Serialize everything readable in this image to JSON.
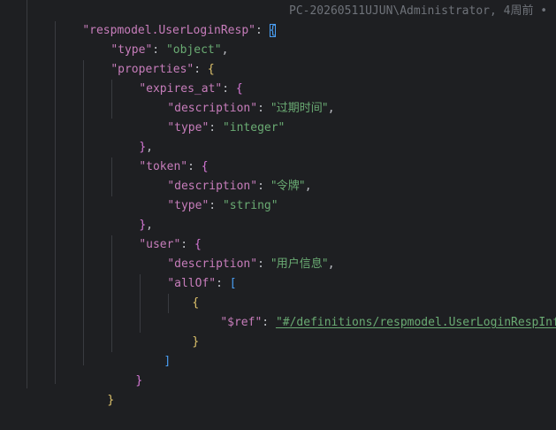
{
  "lines": [
    {
      "key": "\"respmodel.UserLoginResp\"",
      "sep": ": ",
      "open": "{"
    },
    {
      "key": "\"type\"",
      "sep": ": ",
      "value": "\"object\"",
      "tail": ","
    },
    {
      "key": "\"properties\"",
      "sep": ": ",
      "open": "{"
    },
    {
      "key": "\"expires_at\"",
      "sep": ": ",
      "open": "{"
    },
    {
      "key": "\"description\"",
      "sep": ": ",
      "value": "\"过期时间\"",
      "tail": ","
    },
    {
      "key": "\"type\"",
      "sep": ": ",
      "value": "\"integer\""
    },
    {
      "close": "}",
      "tail": ","
    },
    {
      "key": "\"token\"",
      "sep": ": ",
      "open": "{"
    },
    {
      "key": "\"description\"",
      "sep": ": ",
      "value": "\"令牌\"",
      "tail": ","
    },
    {
      "key": "\"type\"",
      "sep": ": ",
      "value": "\"string\""
    },
    {
      "close": "}",
      "tail": ","
    },
    {
      "key": "\"user\"",
      "sep": ": ",
      "open": "{"
    },
    {
      "key": "\"description\"",
      "sep": ": ",
      "value": "\"用户信息\"",
      "tail": ","
    },
    {
      "key": "\"allOf\"",
      "sep": ": ",
      "open": "["
    },
    {
      "open_only": "{"
    },
    {
      "key": "\"$ref\"",
      "sep": ": ",
      "value": "\"#/definitions/respmodel.UserLoginRespInfo\""
    },
    {
      "close": "}"
    },
    {
      "close": "]"
    },
    {
      "close": "}"
    },
    {
      "close": "}"
    }
  ],
  "blame": "PC-20260511UJUN\\Administrator, 4周前 •"
}
